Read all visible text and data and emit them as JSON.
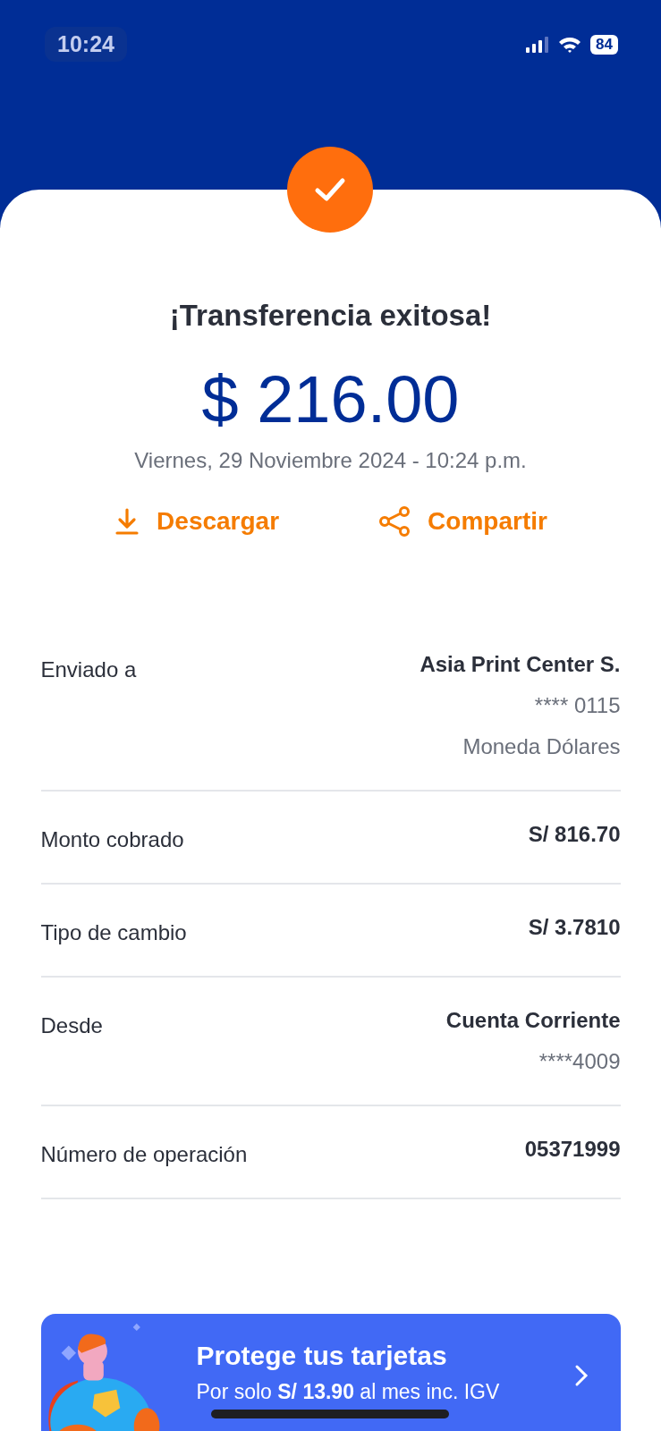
{
  "status_bar": {
    "time": "10:24",
    "battery": "84"
  },
  "result": {
    "title": "¡Transferencia exitosa!",
    "amount": "$ 216.00",
    "date": "Viernes, 29 Noviembre 2024 - 10:24 p.m."
  },
  "actions": [
    {
      "kind": "download",
      "label": "Descargar"
    },
    {
      "kind": "share",
      "label": "Compartir"
    }
  ],
  "details": [
    {
      "label": "Enviado a",
      "values": [
        {
          "text": "Asia Print Center S.",
          "bold": true
        },
        {
          "text": "**** 0115",
          "bold": false
        },
        {
          "text": "Moneda Dólares",
          "bold": false
        }
      ]
    },
    {
      "label": "Monto cobrado",
      "values": [
        {
          "text": "S/ 816.70",
          "bold": true
        }
      ]
    },
    {
      "label": "Tipo de cambio",
      "values": [
        {
          "text": "S/ 3.7810",
          "bold": true
        }
      ]
    },
    {
      "label": "Desde",
      "values": [
        {
          "text": "Cuenta Corriente",
          "bold": true
        },
        {
          "text": "****4009",
          "bold": false
        }
      ]
    },
    {
      "label": "Número de operación",
      "values": [
        {
          "text": "05371999",
          "bold": true
        }
      ]
    }
  ],
  "banner": {
    "title": "Protege tus tarjetas",
    "subtitle": "Por solo **S/ 13.90** al mes inc. IGV"
  }
}
